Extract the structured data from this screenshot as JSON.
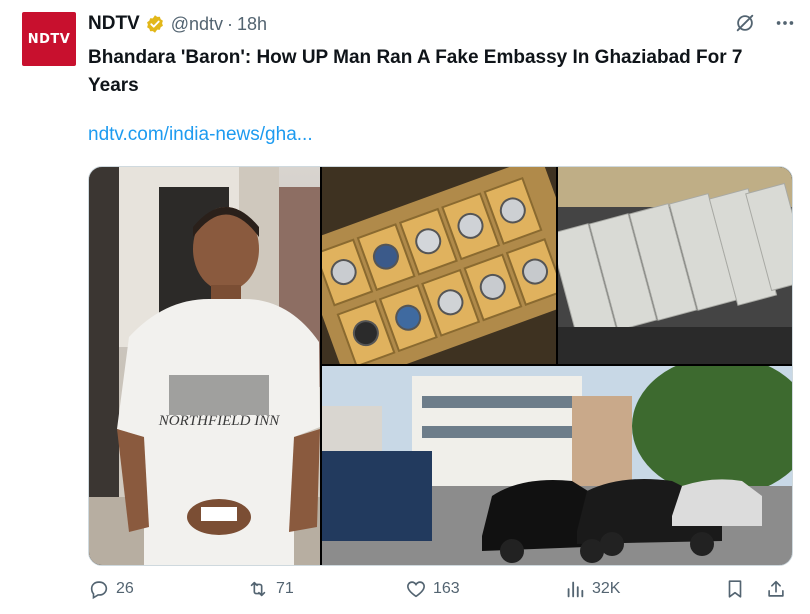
{
  "account": {
    "logo_text": "NDTV",
    "name": "NDTV",
    "handle": "@ndtv",
    "separator": "·",
    "time": "18h"
  },
  "tweet": {
    "text": "Bhandara 'Baron': How UP Man Ran A Fake Embassy In Ghaziabad For 7 Years",
    "link": "ndtv.com/india-news/gha..."
  },
  "media": {
    "images": [
      {
        "name": "man-in-white-tshirt-photo",
        "shirt_text": "NORTHFIELD INN"
      },
      {
        "name": "watch-collection-photo"
      },
      {
        "name": "cash-bundles-photo"
      },
      {
        "name": "embassy-building-cars-photo"
      }
    ]
  },
  "actions": {
    "replies": "26",
    "reposts": "71",
    "likes": "163",
    "views": "32K"
  },
  "colors": {
    "brand": "#c8102e",
    "link": "#1d9bf0",
    "muted": "#536471",
    "verified": "#e2b719"
  },
  "icons": [
    "grok-icon",
    "more-icon",
    "reply-icon",
    "repost-icon",
    "like-icon",
    "views-icon",
    "bookmark-icon",
    "share-icon",
    "verified-badge-icon"
  ]
}
